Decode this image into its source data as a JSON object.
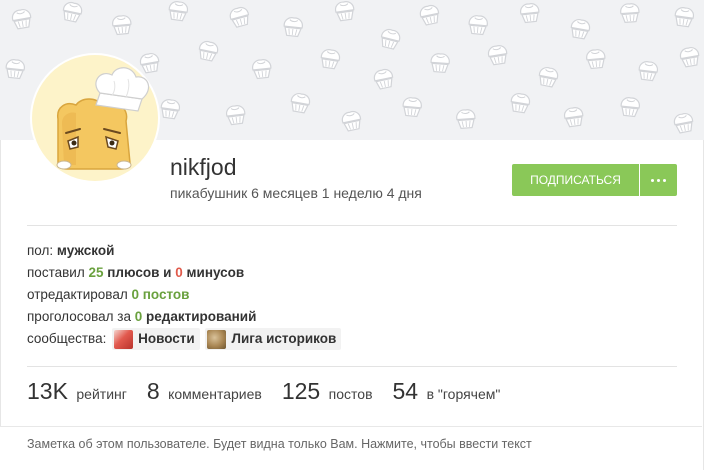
{
  "profile": {
    "username": "nikfjod",
    "age_text": "пикабушник 6 месяцев 1 неделю 4 дня",
    "avatar_icon": "chef-toast-avatar"
  },
  "actions": {
    "subscribe_label": "подписаться",
    "more_icon": "more-dots-icon"
  },
  "info": {
    "gender_label": "пол:",
    "gender_value": "мужской",
    "votes_prefix": "поставил",
    "pluses_count": "25",
    "pluses_label": "плюсов",
    "votes_and": "и",
    "minuses_count": "0",
    "minuses_label": "минусов",
    "edited_prefix": "отредактировал",
    "edited_count": "0",
    "edited_label": "постов",
    "voted_prefix": "проголосовал за",
    "voted_count": "0",
    "voted_label": "редактирований",
    "communities_label": "сообщества:",
    "communities": [
      {
        "name": "Новости",
        "icon": "news-community-icon"
      },
      {
        "name": "Лига историков",
        "icon": "historians-community-icon"
      }
    ]
  },
  "stats": [
    {
      "value": "13K",
      "label": "рейтинг"
    },
    {
      "value": "8",
      "label": "комментариев"
    },
    {
      "value": "125",
      "label": "постов"
    },
    {
      "value": "54",
      "label": "в \"горячем\""
    }
  ],
  "note": {
    "placeholder": "Заметка об этом пользователе. Будет видна только Вам. Нажмите, чтобы ввести текст"
  },
  "colors": {
    "accent_green": "#8ac858",
    "plus_green": "#6aa13e",
    "minus_red": "#e05a4b",
    "banner_bg": "#f1f2f4"
  }
}
